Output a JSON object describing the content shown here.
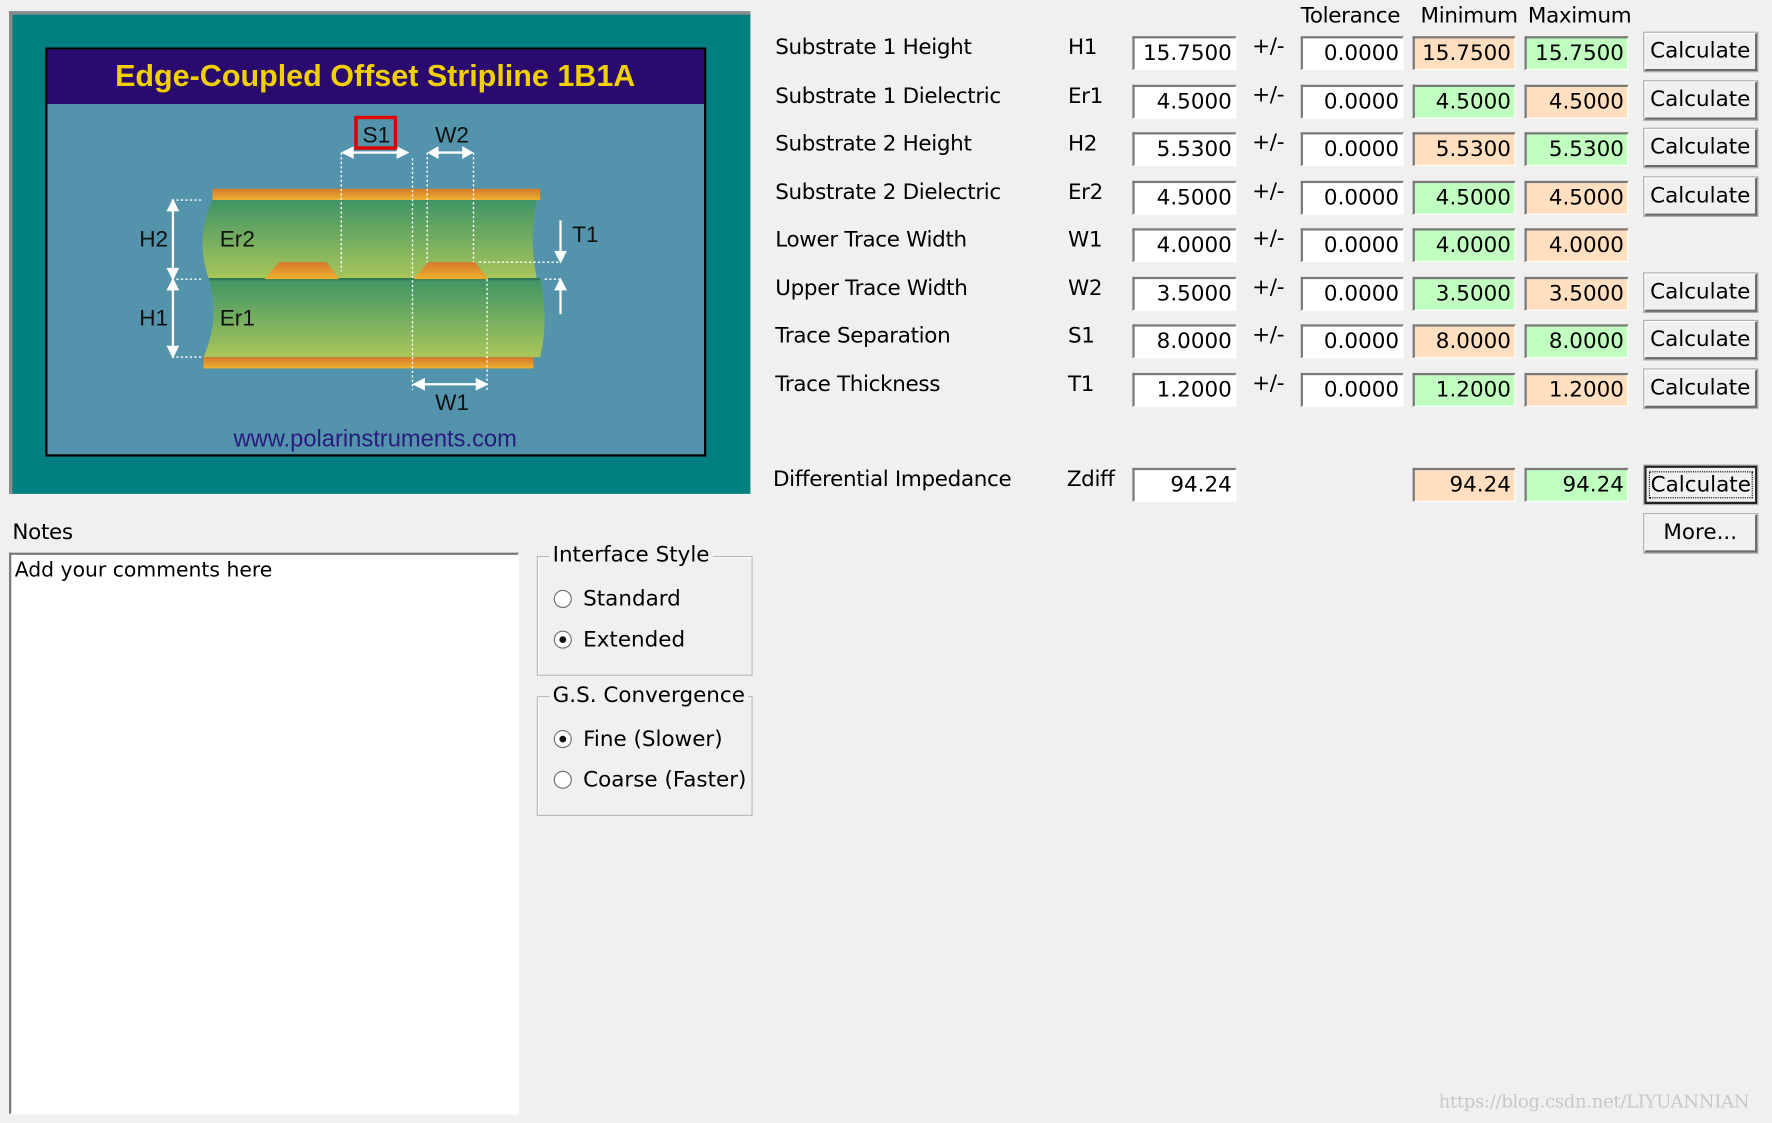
{
  "diagram": {
    "title": "Edge-Coupled Offset Stripline 1B1A",
    "url": "www.polarinstruments.com",
    "labels": {
      "s1": "S1",
      "w2": "W2",
      "w1": "W1",
      "h1": "H1",
      "h2": "H2",
      "er1": "Er1",
      "er2": "Er2",
      "t1": "T1"
    },
    "colors": {
      "frame": "#008080",
      "title_bg": "#2a0a6e",
      "title_text": "#f0d000",
      "body": "#5393ab",
      "copper": "#e8922a",
      "dielectric": "#7fb060",
      "highlight": "#e00000"
    }
  },
  "headers": {
    "tolerance": "Tolerance",
    "minimum": "Minimum",
    "maximum": "Maximum"
  },
  "pm": "+/-",
  "params": [
    {
      "label": "Substrate 1 Height",
      "symbol": "H1",
      "value": "15.7500",
      "tol": "0.0000",
      "min": "15.7500",
      "max": "15.7500",
      "min_color": "orange",
      "max_color": "green",
      "button": "Calculate"
    },
    {
      "label": "Substrate 1 Dielectric",
      "symbol": "Er1",
      "value": "4.5000",
      "tol": "0.0000",
      "min": "4.5000",
      "max": "4.5000",
      "min_color": "green",
      "max_color": "orange",
      "button": "Calculate"
    },
    {
      "label": "Substrate 2 Height",
      "symbol": "H2",
      "value": "5.5300",
      "tol": "0.0000",
      "min": "5.5300",
      "max": "5.5300",
      "min_color": "orange",
      "max_color": "green",
      "button": "Calculate"
    },
    {
      "label": "Substrate 2 Dielectric",
      "symbol": "Er2",
      "value": "4.5000",
      "tol": "0.0000",
      "min": "4.5000",
      "max": "4.5000",
      "min_color": "green",
      "max_color": "orange",
      "button": "Calculate"
    },
    {
      "label": "Lower Trace Width",
      "symbol": "W1",
      "value": "4.0000",
      "tol": "0.0000",
      "min": "4.0000",
      "max": "4.0000",
      "min_color": "green",
      "max_color": "orange",
      "button": null
    },
    {
      "label": "Upper Trace Width",
      "symbol": "W2",
      "value": "3.5000",
      "tol": "0.0000",
      "min": "3.5000",
      "max": "3.5000",
      "min_color": "green",
      "max_color": "orange",
      "button": "Calculate"
    },
    {
      "label": "Trace Separation",
      "symbol": "S1",
      "value": "8.0000",
      "tol": "0.0000",
      "min": "8.0000",
      "max": "8.0000",
      "min_color": "orange",
      "max_color": "green",
      "button": "Calculate"
    },
    {
      "label": "Trace Thickness",
      "symbol": "T1",
      "value": "1.2000",
      "tol": "0.0000",
      "min": "1.2000",
      "max": "1.2000",
      "min_color": "green",
      "max_color": "orange",
      "button": "Calculate"
    }
  ],
  "result": {
    "label": "Differential Impedance",
    "symbol": "Zdiff",
    "value": "94.24",
    "min": "94.24",
    "max": "94.24",
    "button": "Calculate",
    "more": "More..."
  },
  "notes": {
    "label": "Notes",
    "value": "Add your comments here"
  },
  "interface_style": {
    "title": "Interface Style",
    "options": [
      {
        "label": "Standard",
        "checked": false
      },
      {
        "label": "Extended",
        "checked": true
      }
    ]
  },
  "convergence": {
    "title": "G.S. Convergence",
    "options": [
      {
        "label": "Fine (Slower)",
        "checked": true
      },
      {
        "label": "Coarse (Faster)",
        "checked": false
      }
    ]
  },
  "watermark": "https://blog.csdn.net/LIYUANNIAN"
}
